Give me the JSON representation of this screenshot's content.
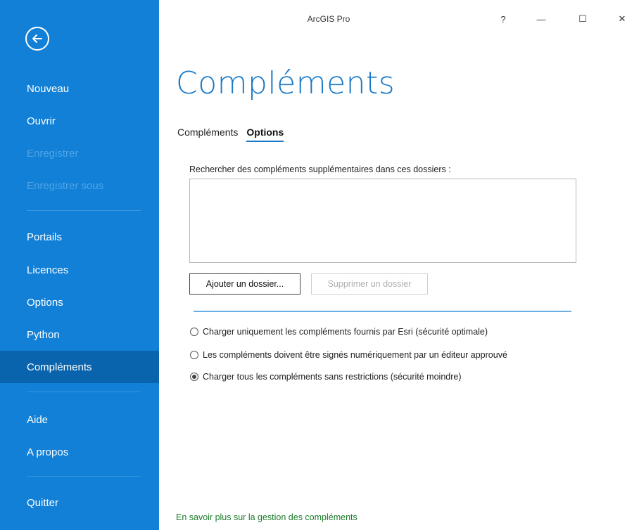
{
  "window": {
    "title": "ArcGIS Pro",
    "help_label": "?",
    "minimize_label": "—",
    "maximize_label": "☐",
    "close_label": "✕"
  },
  "sidebar": {
    "back_icon": "back-arrow-icon",
    "items": [
      {
        "label": "Nouveau",
        "state": "normal"
      },
      {
        "label": "Ouvrir",
        "state": "normal"
      },
      {
        "label": "Enregistrer",
        "state": "disabled"
      },
      {
        "label": "Enregistrer sous",
        "state": "disabled"
      },
      {
        "label": "Portails",
        "state": "normal"
      },
      {
        "label": "Licences",
        "state": "normal"
      },
      {
        "label": "Options",
        "state": "normal"
      },
      {
        "label": "Python",
        "state": "normal"
      },
      {
        "label": "Compléments",
        "state": "active"
      },
      {
        "label": "Aide",
        "state": "normal"
      },
      {
        "label": "A propos",
        "state": "normal"
      },
      {
        "label": "Quitter",
        "state": "normal"
      }
    ]
  },
  "main": {
    "title": "Compléments",
    "tabs": [
      {
        "label": "Compléments",
        "active": false
      },
      {
        "label": "Options",
        "active": true
      }
    ],
    "search_label": "Rechercher des compléments supplémentaires dans ces dossiers :",
    "folders": [],
    "add_folder_label": "Ajouter un dossier...",
    "remove_folder_label": "Supprimer un dossier",
    "security_options": [
      {
        "label": "Charger uniquement les compléments fournis par Esri (sécurité optimale)",
        "checked": false
      },
      {
        "label": "Les compléments doivent être signés numériquement par un éditeur approuvé",
        "checked": false
      },
      {
        "label": "Charger tous les compléments sans restrictions (sécurité moindre)",
        "checked": true
      }
    ],
    "learn_more": "En savoir plus sur la gestion des compléments"
  },
  "colors": {
    "sidebar_bg": "#1180d6",
    "sidebar_active": "#0a64ad",
    "accent": "#1a79c6",
    "link": "#1a7a2a"
  }
}
